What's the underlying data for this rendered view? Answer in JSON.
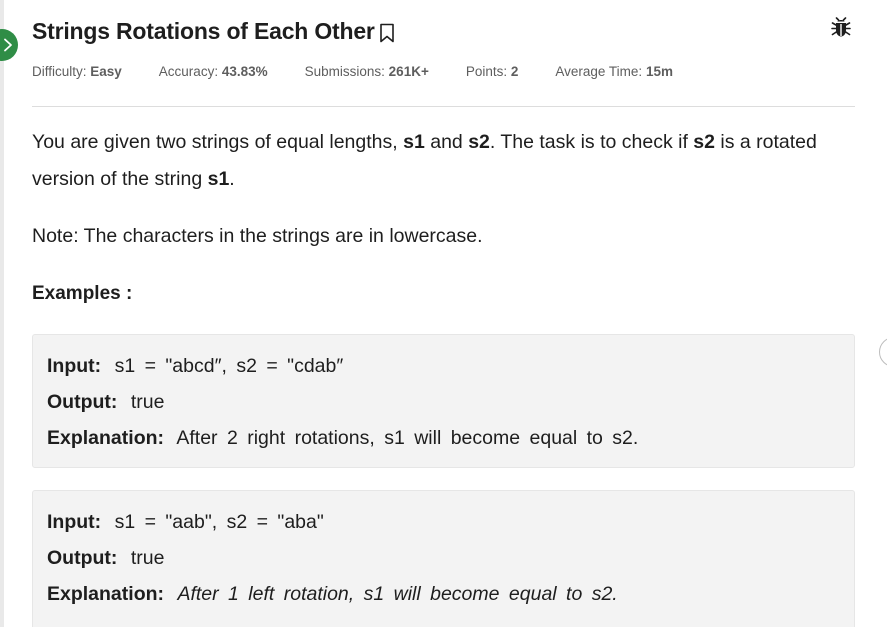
{
  "problem": {
    "title": "Strings Rotations of Each Other",
    "meta": [
      {
        "label": "Difficulty: ",
        "value": "Easy"
      },
      {
        "label": "Accuracy: ",
        "value": "43.83%"
      },
      {
        "label": "Submissions: ",
        "value": "261K+"
      },
      {
        "label": "Points: ",
        "value": "2"
      },
      {
        "label": "Average Time: ",
        "value": "15m"
      }
    ],
    "statement": {
      "part1": "You are given two strings of equal lengths, ",
      "s1": "s1",
      "part2": " and ",
      "s2": "s2",
      "part3": ". The task is to check if ",
      "s2b": "s2",
      "part4": " is a rotated version of the string ",
      "s1b": "s1",
      "part5": "."
    },
    "note": "Note: The characters in the strings are in lowercase.",
    "examples_heading": "Examples :",
    "examples": [
      {
        "input_label": "Input:",
        "input": "s1 = \"abcd″, s2 = \"cdab″",
        "output_label": "Output:",
        "output": "true",
        "explanation_label": "Explanation:",
        "explanation": "After 2 right rotations, s1 will become equal to s2."
      },
      {
        "input_label": "Input:",
        "input": "s1 = \"aab\", s2 = \"aba\"",
        "output_label": "Output:",
        "output": "true",
        "explanation_label": "Explanation:",
        "explanation": "After 1 left rotation, s1 will become equal to s2."
      }
    ]
  },
  "icons": {
    "collapse": "chevron-right-icon",
    "bookmark": "bookmark-icon",
    "report": "bug-icon"
  },
  "colors": {
    "accent_green": "#2f8d46",
    "example_bg": "#f3f3f3",
    "meta_text": "#5e5e5e"
  }
}
